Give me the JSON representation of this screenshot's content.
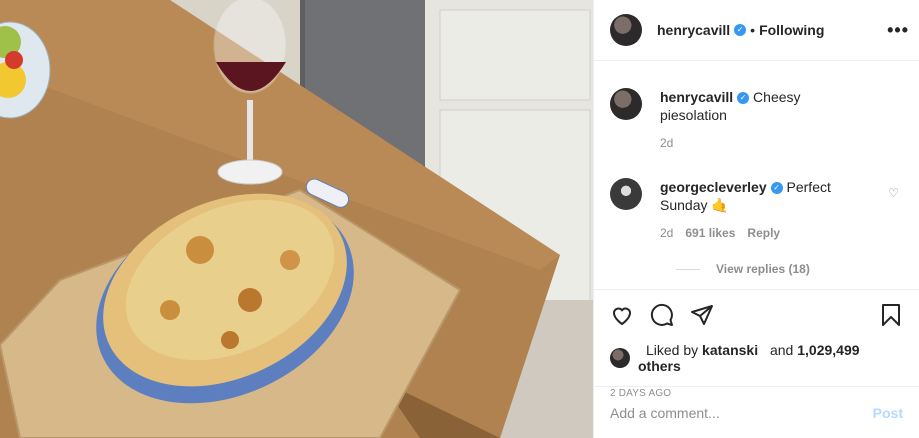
{
  "post": {
    "photo_alt": "",
    "author": {
      "username": "henrycavill",
      "verified_icon": "verified-badge-icon",
      "follow_state": "Following",
      "separator": "•"
    },
    "more_icon": "more-options-icon",
    "caption": {
      "username": "henrycavill",
      "text": "Cheesy piesolation",
      "age": "2d"
    },
    "comments": [
      {
        "username": "georgecleverley",
        "text": "Perfect Sunday 🤙",
        "age": "2d",
        "likes": "691 likes",
        "reply_label": "Reply",
        "view_replies": "View replies (18)"
      }
    ],
    "actions": {
      "like_icon": "heart-icon",
      "comment_icon": "comment-icon",
      "share_icon": "send-icon",
      "save_icon": "bookmark-icon"
    },
    "likes_line": {
      "prefix": "Liked by",
      "user": "katanski",
      "joiner": "and",
      "others": "1,029,499 others"
    },
    "date": "2 DAYS AGO",
    "add_comment": {
      "placeholder": "Add a comment...",
      "post_label": "Post"
    }
  },
  "colors": {
    "accent": "#3897f0",
    "post_disabled": "#b3dbff",
    "muted": "#8e8e8e"
  }
}
